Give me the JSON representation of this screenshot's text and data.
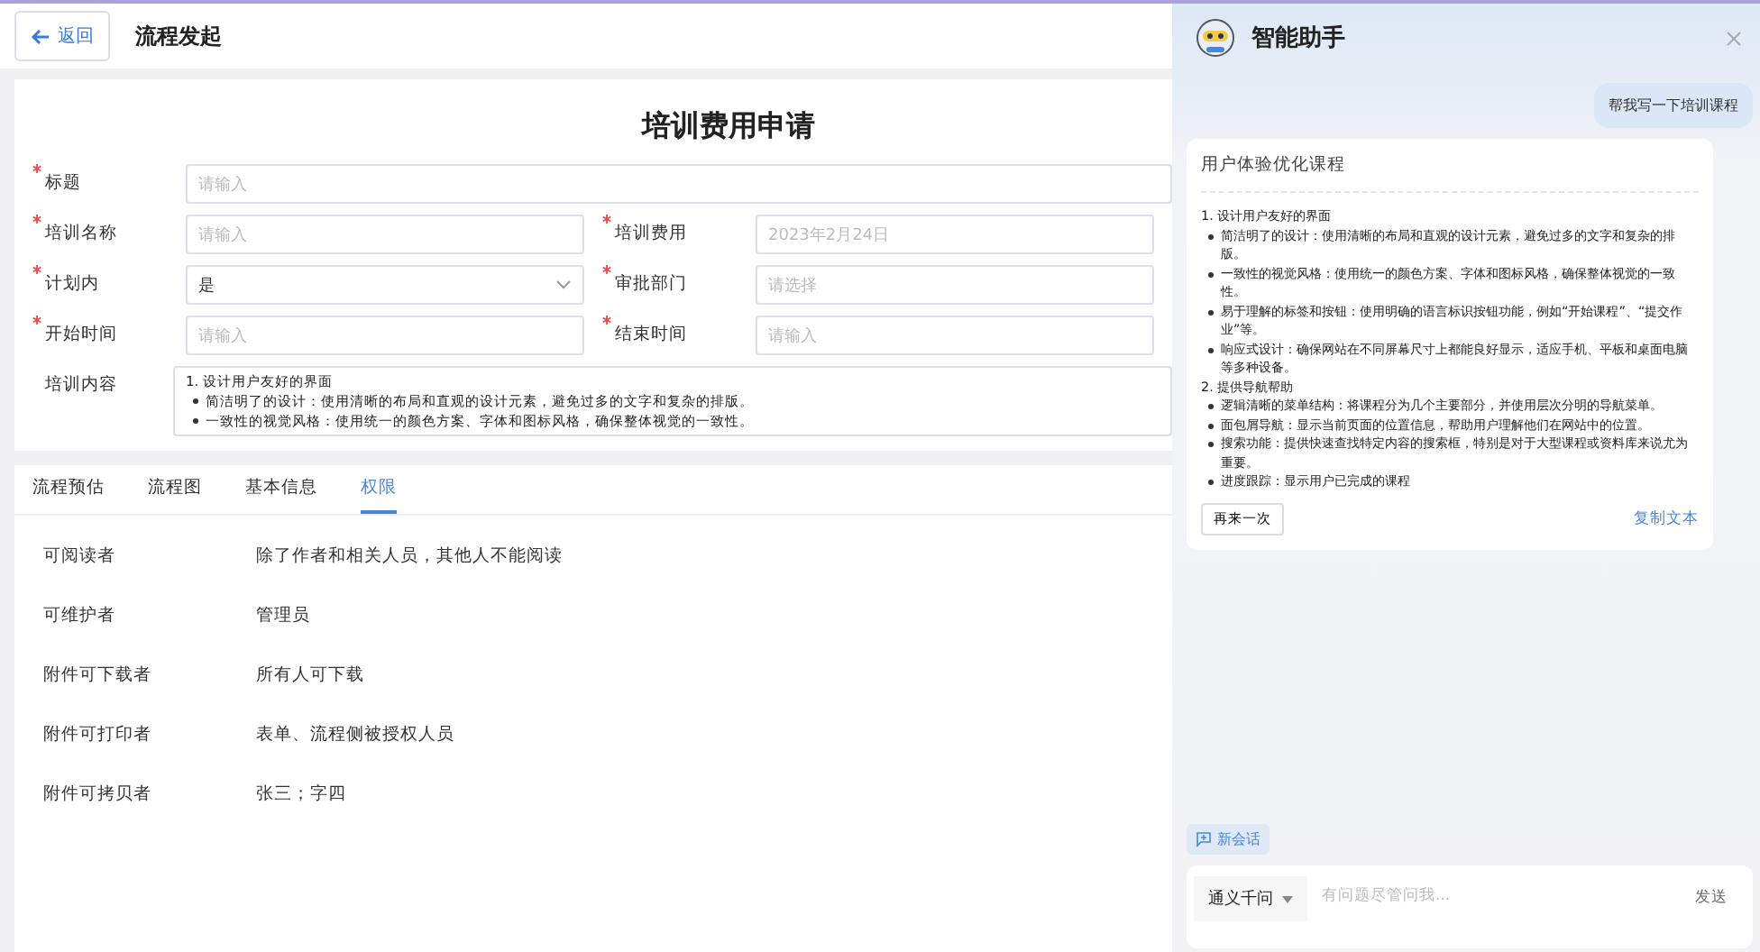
{
  "header": {
    "back": "返回",
    "title": "流程发起"
  },
  "form": {
    "title": "培训费用申请",
    "rows": [
      [
        {
          "label": "标题",
          "required": true,
          "kind": "text",
          "placeholder": "请输入"
        }
      ],
      [
        {
          "label": "培训名称",
          "required": true,
          "kind": "text",
          "placeholder": "请输入"
        },
        {
          "label": "培训费用",
          "required": true,
          "kind": "text",
          "placeholder": "2023年2月24日"
        }
      ],
      [
        {
          "label": "计划内",
          "required": true,
          "kind": "select",
          "value": "是"
        },
        {
          "label": "审批部门",
          "required": true,
          "kind": "text",
          "placeholder": "请选择"
        }
      ],
      [
        {
          "label": "开始时间",
          "required": true,
          "kind": "text",
          "placeholder": "请输入"
        },
        {
          "label": "结束时间",
          "required": true,
          "kind": "text",
          "placeholder": "请输入"
        }
      ]
    ],
    "content": {
      "label": "培训内容",
      "required": false,
      "heading": "1. 设计用户友好的界面",
      "bullets": [
        "简洁明了的设计：使用清晰的布局和直观的设计元素，避免过多的文字和复杂的排版。",
        "一致性的视觉风格：使用统一的颜色方案、字体和图标风格，确保整体视觉的一致性。"
      ]
    }
  },
  "tabs": [
    {
      "label": "流程预估",
      "selected": false
    },
    {
      "label": "流程图",
      "selected": false
    },
    {
      "label": "基本信息",
      "selected": false
    },
    {
      "label": "权限",
      "selected": true
    }
  ],
  "permissions": [
    {
      "label": "可阅读者",
      "value": "除了作者和相关人员，其他人不能阅读"
    },
    {
      "label": "可维护者",
      "value": "管理员"
    },
    {
      "label": "附件可下载者",
      "value": "所有人可下载"
    },
    {
      "label": "附件可打印者",
      "value": "表单、流程侧被授权人员"
    },
    {
      "label": "附件可拷贝者",
      "value": "张三；字四"
    }
  ],
  "assistant": {
    "title": "智能助手",
    "user_message": "帮我写一下培训课程",
    "answer": {
      "title": "用户体验优化课程",
      "sections": [
        {
          "heading": "1. 设计用户友好的界面",
          "bullets": [
            "简洁明了的设计：使用清晰的布局和直观的设计元素，避免过多的文字和复杂的排版。",
            "一致性的视觉风格：使用统一的颜色方案、字体和图标风格，确保整体视觉的一致性。",
            "易于理解的标签和按钮：使用明确的语言标识按钮功能，例如“开始课程”、“提交作业”等。",
            "响应式设计：确保网站在不同屏幕尺寸上都能良好显示，适应手机、平板和桌面电脑等多种设备。"
          ]
        },
        {
          "heading": "2. 提供导航帮助",
          "bullets": [
            "逻辑清晰的菜单结构：将课程分为几个主要部分，并使用层次分明的导航菜单。",
            "面包屑导航：显示当前页面的位置信息，帮助用户理解他们在网站中的位置。",
            "搜索功能：提供快速查找特定内容的搜索框，特别是对于大型课程或资料库来说尤为重要。",
            "进度跟踪：显示用户已完成的课程"
          ]
        }
      ],
      "retry": "再来一次",
      "copy": "复制文本"
    },
    "new_chat": "新会话",
    "model": "通义千问",
    "input": {
      "placeholder": "有问题尽管问我..."
    },
    "send": "发送"
  }
}
